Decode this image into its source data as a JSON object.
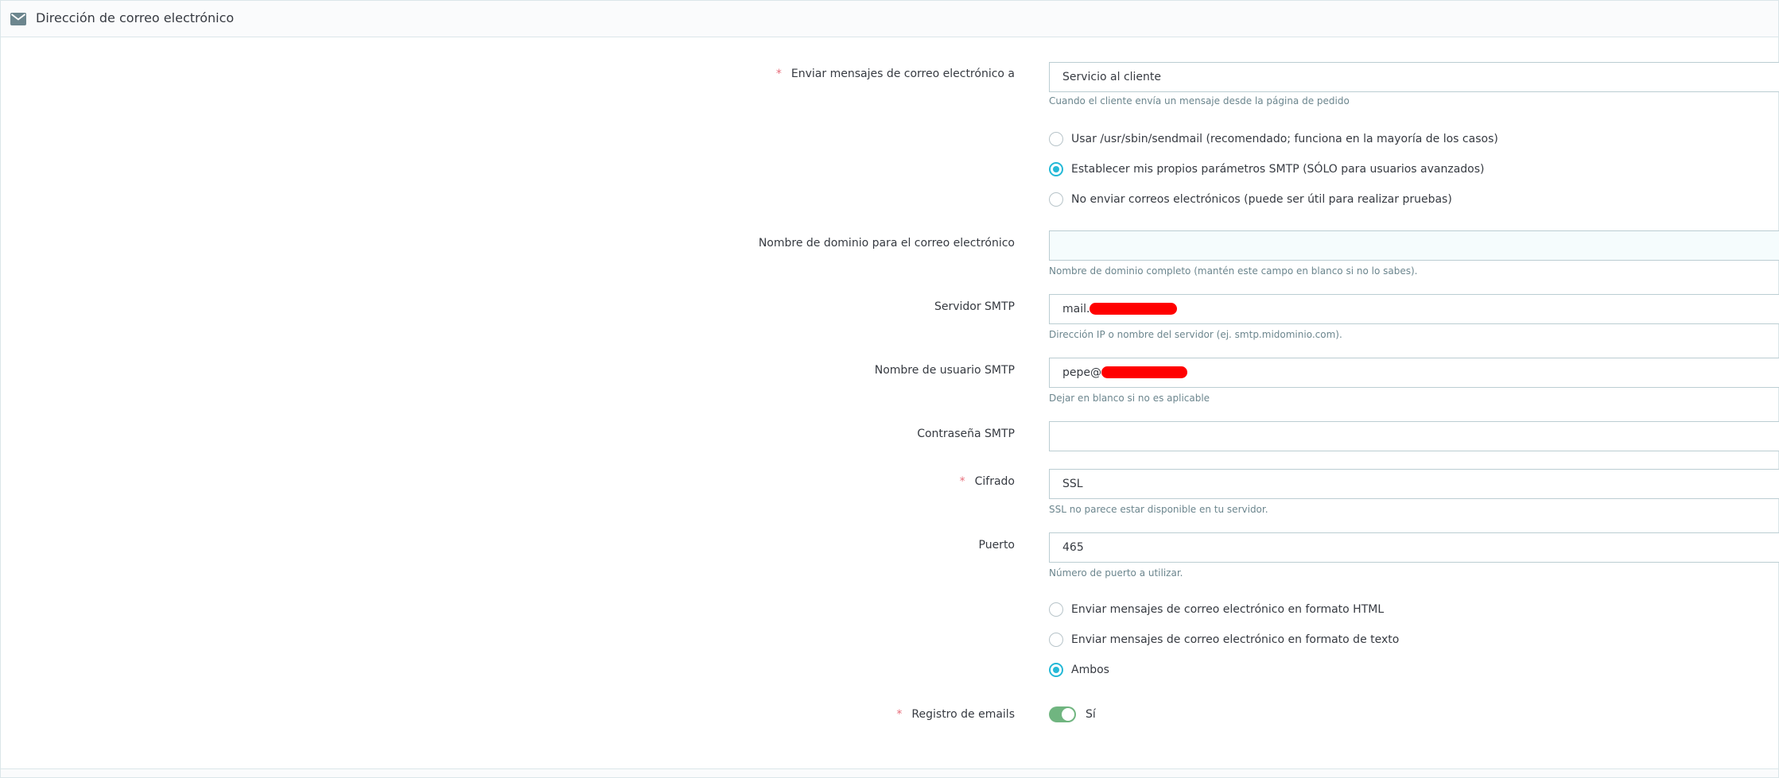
{
  "panel": {
    "title": "Dirección de correo electrónico",
    "icon": "envelope-icon"
  },
  "fields": {
    "send_to": {
      "label": "Enviar mensajes de correo electrónico a",
      "required_mark": "*",
      "value": "Servicio al cliente",
      "help": "Cuando el cliente envía un mensaje desde la página de pedido"
    },
    "mail_method": {
      "options": [
        {
          "label": "Usar /usr/sbin/sendmail (recomendado; funciona en la mayoría de los casos)",
          "checked": false
        },
        {
          "label": "Establecer mis propios parámetros SMTP (SÓLO para usuarios avanzados)",
          "checked": true
        },
        {
          "label": "No enviar correos electrónicos (puede ser útil para realizar pruebas)",
          "checked": false
        }
      ]
    },
    "domain": {
      "label": "Nombre de dominio para el correo electrónico",
      "value": "",
      "help": "Nombre de dominio completo (mantén este campo en blanco si no lo sabes)."
    },
    "smtp_server": {
      "label": "Servidor SMTP",
      "value": "mail.",
      "help": "Dirección IP o nombre del servidor (ej. smtp.midominio.com)."
    },
    "smtp_user": {
      "label": "Nombre de usuario SMTP",
      "value": "pepe@",
      "help": "Dejar en blanco si no es aplicable"
    },
    "smtp_password": {
      "label": "Contraseña SMTP",
      "value": ""
    },
    "encryption": {
      "label": "Cifrado",
      "required_mark": "*",
      "value": "SSL",
      "help": "SSL no parece estar disponible en tu servidor."
    },
    "port": {
      "label": "Puerto",
      "value": "465",
      "help": "Número de puerto a utilizar."
    },
    "mail_format": {
      "options": [
        {
          "label": "Enviar mensajes de correo electrónico en formato HTML",
          "checked": false
        },
        {
          "label": "Enviar mensajes de correo electrónico en formato de texto",
          "checked": false
        },
        {
          "label": "Ambos",
          "checked": true
        }
      ]
    },
    "email_log": {
      "label": "Registro de emails",
      "required_mark": "*",
      "value": "Sí",
      "enabled": true
    }
  },
  "colors": {
    "accent": "#25b9d7",
    "switch_on": "#70b580",
    "required": "#e76d7a",
    "redaction": "#ff0000"
  }
}
